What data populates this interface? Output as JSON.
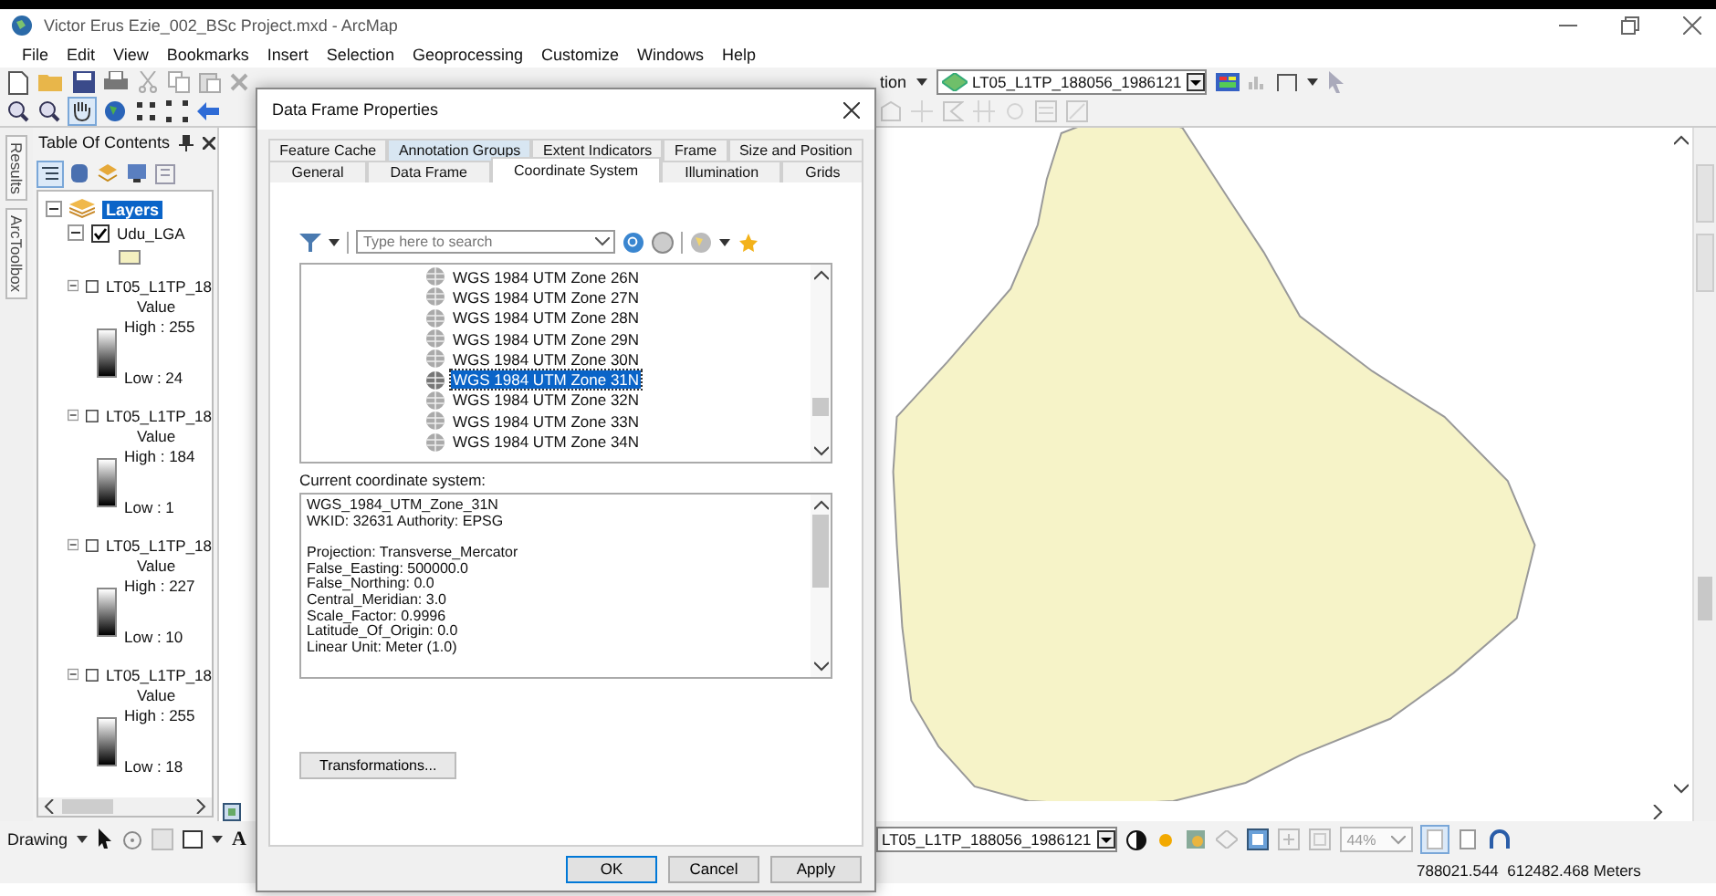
{
  "window": {
    "title": "Victor Erus Ezie_002_BSc Project.mxd - ArcMap"
  },
  "menu": [
    "File",
    "Edit",
    "View",
    "Bookmarks",
    "Insert",
    "Selection",
    "Geoprocessing",
    "Customize",
    "Windows",
    "Help"
  ],
  "toolbar": {
    "selection_menu": "tion",
    "layer_dropdown": "LT05_L1TP_188056_1986121"
  },
  "toc": {
    "title": "Table Of Contents",
    "side_tabs": [
      "Results",
      "ArcToolbox"
    ],
    "root": {
      "label": "Layers",
      "selected": true,
      "expanded": true,
      "children": [
        {
          "kind": "vector",
          "name": "Udu_LGA",
          "checked": true,
          "expanded": true
        },
        {
          "kind": "raster",
          "name": "LT05_L1TP_18",
          "checked": false,
          "expanded": true,
          "legend_title": "Value",
          "high": "High : 255",
          "low": "Low : 24"
        },
        {
          "kind": "raster",
          "name": "LT05_L1TP_18",
          "checked": false,
          "expanded": true,
          "legend_title": "Value",
          "high": "High : 184",
          "low": "Low : 1"
        },
        {
          "kind": "raster",
          "name": "LT05_L1TP_18",
          "checked": false,
          "expanded": true,
          "legend_title": "Value",
          "high": "High : 227",
          "low": "Low : 10"
        },
        {
          "kind": "raster",
          "name": "LT05_L1TP_18",
          "checked": false,
          "expanded": true,
          "legend_title": "Value",
          "high": "High : 255",
          "low": "Low : 18"
        }
      ]
    }
  },
  "dialog": {
    "title": "Data Frame Properties",
    "tabs_row1": [
      {
        "label": "Feature Cache",
        "selected": false,
        "hovered": false
      },
      {
        "label": "Annotation Groups",
        "selected": false,
        "hovered": true
      },
      {
        "label": "Extent Indicators",
        "selected": false,
        "hovered": false
      },
      {
        "label": "Frame",
        "selected": false,
        "hovered": false
      },
      {
        "label": "Size and Position",
        "selected": false,
        "hovered": false
      }
    ],
    "tabs_row2": [
      {
        "label": "General",
        "selected": false,
        "hovered": false
      },
      {
        "label": "Data Frame",
        "selected": false,
        "hovered": false
      },
      {
        "label": "Coordinate System",
        "selected": true,
        "hovered": false
      },
      {
        "label": "Illumination",
        "selected": false,
        "hovered": false
      },
      {
        "label": "Grids",
        "selected": false,
        "hovered": false
      }
    ],
    "search": {
      "placeholder": "Type here to search"
    },
    "systems": [
      {
        "label": "WGS 1984 UTM Zone 26N",
        "selected": false
      },
      {
        "label": "WGS 1984 UTM Zone 27N",
        "selected": false
      },
      {
        "label": "WGS 1984 UTM Zone 28N",
        "selected": false
      },
      {
        "label": "WGS 1984 UTM Zone 29N",
        "selected": false
      },
      {
        "label": "WGS 1984 UTM Zone 30N",
        "selected": false
      },
      {
        "label": "WGS 1984 UTM Zone 31N",
        "selected": true
      },
      {
        "label": "WGS 1984 UTM Zone 32N",
        "selected": false
      },
      {
        "label": "WGS 1984 UTM Zone 33N",
        "selected": false
      },
      {
        "label": "WGS 1984 UTM Zone 34N",
        "selected": false
      }
    ],
    "current_label": "Current coordinate system:",
    "details": [
      [
        "WGS_1984_UTM_Zone_31N",
        "WKID: 32631 Authority: EPSG"
      ],
      [
        "Projection: Transverse_Mercator",
        "False_Easting: 500000.0",
        "False_Northing: 0.0",
        "Central_Meridian: 3.0",
        "Scale_Factor: 0.9996",
        "Latitude_Of_Origin: 0.0",
        "Linear Unit: Meter (1.0)"
      ]
    ],
    "transformations": "Transformations...",
    "buttons": [
      {
        "label": "OK",
        "kind": "default"
      },
      {
        "label": "Cancel",
        "kind": "normal"
      },
      {
        "label": "Apply",
        "kind": "normal"
      }
    ]
  },
  "bottom_toolbar": {
    "drawing": "Drawing",
    "text_tool": "A",
    "layer_dropdown": "LT05_L1TP_188056_1986121",
    "zoom": "44%"
  },
  "status_bar": {
    "coordinates": "788021.544  612482.468 Meters"
  }
}
